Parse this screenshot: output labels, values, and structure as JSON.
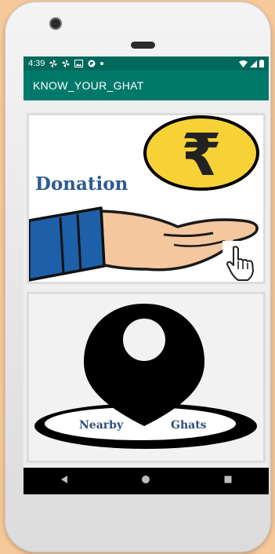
{
  "status_bar": {
    "time": "4:39",
    "icons": [
      "notification-pinwheel-icon",
      "notification-pinwheel-icon",
      "photo-icon",
      "sync-icon",
      "dot-icon",
      "wifi-icon",
      "signal-icon",
      "battery-icon"
    ]
  },
  "app_bar": {
    "title": "KNOW_YOUR_GHAT"
  },
  "donation_card": {
    "label": "Donation",
    "currency_symbol": "₹",
    "coin_color": "#f7d236",
    "sleeve_color": "#1d5fa8",
    "skin_color": "#f5c79e"
  },
  "ghats_card": {
    "label_left": "Nearby",
    "label_right": "Ghats"
  },
  "colors": {
    "status_bar": "#00695c",
    "app_bar": "#00796b",
    "nav_bar": "#000000",
    "donation_text": "#2f5b8f"
  },
  "nav_bar": {
    "icons": [
      "back-icon",
      "home-icon",
      "recents-icon"
    ]
  }
}
